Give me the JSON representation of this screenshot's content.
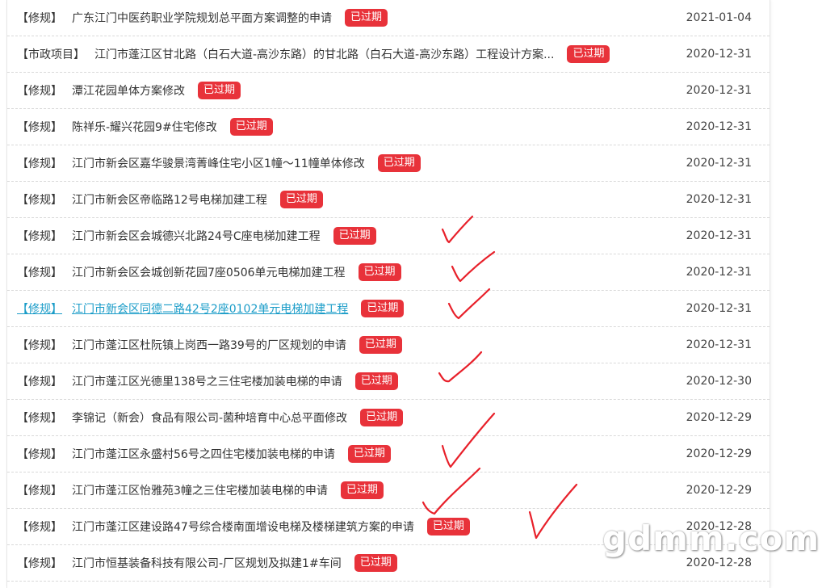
{
  "items": [
    {
      "tag": "【修规】",
      "title": "广东江门中医药职业学院规划总平面方案调整的申请",
      "badge": "已过期",
      "date": "2021-01-04"
    },
    {
      "tag": "【市政项目】",
      "title": "江门市蓬江区甘北路（白石大道-高沙东路）的甘北路（白石大道-高沙东路）工程设计方案...",
      "badge": "已过期",
      "date": "2020-12-31"
    },
    {
      "tag": "【修规】",
      "title": "潭江花园单体方案修改",
      "badge": "已过期",
      "date": "2020-12-31"
    },
    {
      "tag": "【修规】",
      "title": "陈祥乐-耀兴花园9#住宅修改",
      "badge": "已过期",
      "date": "2020-12-31"
    },
    {
      "tag": "【修规】",
      "title": "江门市新会区嘉华骏景湾菁峰住宅小区1幢～11幢单体修改",
      "badge": "已过期",
      "date": "2020-12-31"
    },
    {
      "tag": "【修规】",
      "title": "江门市新会区帝临路12号电梯加建工程",
      "badge": "已过期",
      "date": "2020-12-31"
    },
    {
      "tag": "【修规】",
      "title": "江门市新会区会城德兴北路24号C座电梯加建工程",
      "badge": "已过期",
      "date": "2020-12-31"
    },
    {
      "tag": "【修规】",
      "title": "江门市新会区会城创新花园7座0506单元电梯加建工程",
      "badge": "已过期",
      "date": "2020-12-31"
    },
    {
      "tag": "【修规】",
      "title": "江门市新会区同德二路42号2座0102单元电梯加建工程",
      "badge": "已过期",
      "date": "2020-12-31",
      "active": true
    },
    {
      "tag": "【修规】",
      "title": "江门市蓬江区杜阮镇上岗西一路39号的厂区规划的申请",
      "badge": "已过期",
      "date": "2020-12-31"
    },
    {
      "tag": "【修规】",
      "title": "江门市蓬江区光德里138号之三住宅楼加装电梯的申请",
      "badge": "已过期",
      "date": "2020-12-30"
    },
    {
      "tag": "【修规】",
      "title": "李锦记（新会）食品有限公司-菌种培育中心总平面修改",
      "badge": "已过期",
      "date": "2020-12-29"
    },
    {
      "tag": "【修规】",
      "title": "江门市蓬江区永盛村56号之四住宅楼加装电梯的申请",
      "badge": "已过期",
      "date": "2020-12-29"
    },
    {
      "tag": "【修规】",
      "title": "江门市蓬江区怡雅苑3幢之三住宅楼加装电梯的申请",
      "badge": "已过期",
      "date": "2020-12-29"
    },
    {
      "tag": "【修规】",
      "title": "江门市蓬江区建设路47号综合楼南面增设电梯及楼梯建筑方案的申请",
      "badge": "已过期",
      "date": "2020-12-28"
    },
    {
      "tag": "【修规】",
      "title": "江门市恒基装备科技有限公司-厂区规划及拟建1#车间",
      "badge": "已过期",
      "date": "2020-12-28"
    }
  ],
  "watermark": "gdmm.com",
  "colors": {
    "badge": "#e8323a",
    "link_active": "#1a9cc8",
    "checkmark": "#e8202a"
  }
}
